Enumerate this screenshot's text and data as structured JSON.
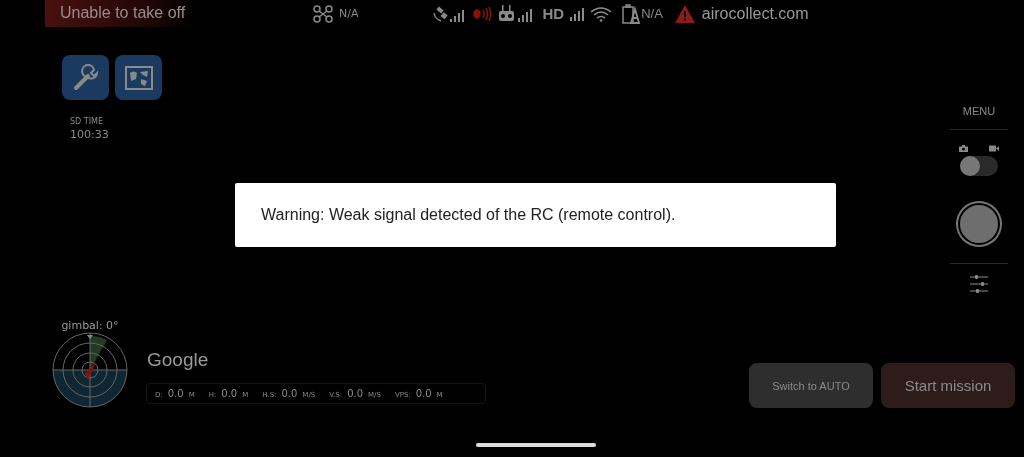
{
  "status_bar": {
    "takeoff_status": "Unable to take off",
    "aircraft_reading": "N/A",
    "hd_label": "HD",
    "battery_reading": "N/A",
    "website": "airocollect.com"
  },
  "tools": [
    {
      "kind": "wrench"
    },
    {
      "kind": "map"
    }
  ],
  "sd_time": {
    "label": "SD TIME",
    "value": "100:33"
  },
  "camera_panel": {
    "menu_label": "MENU",
    "video_mode": false
  },
  "dialog": {
    "message": "Warning: Weak signal detected of the RC (remote control)."
  },
  "gimbal": {
    "label": "gimbal: 0°"
  },
  "map_attribution": "Google",
  "telemetry": [
    {
      "label": "D:",
      "value": "0.0",
      "unit": "M"
    },
    {
      "label": "H:",
      "value": "0.0",
      "unit": "M"
    },
    {
      "label": "H.S:",
      "value": "0.0",
      "unit": "M/S"
    },
    {
      "label": "V.S:",
      "value": "0.0",
      "unit": "M/S"
    },
    {
      "label": "VPS:",
      "value": "0.0",
      "unit": "M"
    }
  ],
  "buttons": [
    {
      "label": "Switch to AUTO",
      "kind": "secondary"
    },
    {
      "label": "Start mission",
      "kind": "primary"
    }
  ]
}
